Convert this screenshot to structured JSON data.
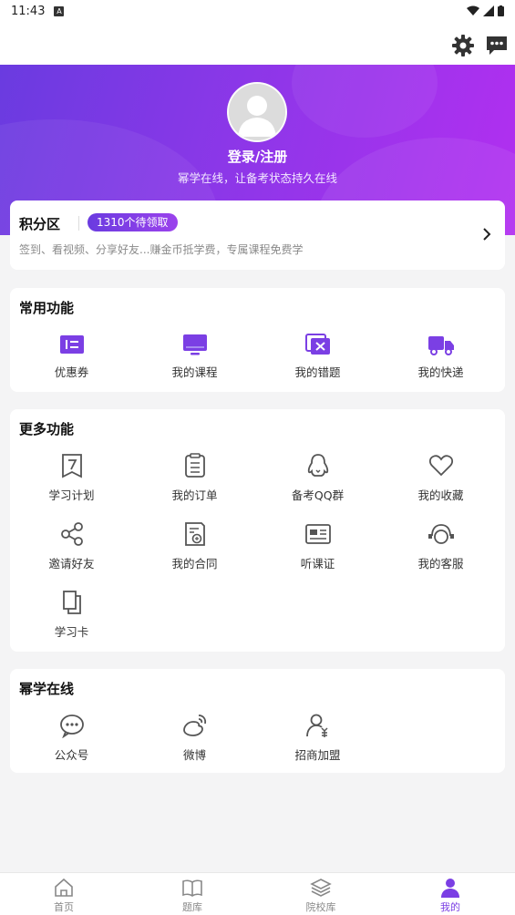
{
  "status_bar": {
    "time": "11:43",
    "notification_badge": "A"
  },
  "hero": {
    "login_label": "登录/注册",
    "slogan": "幂学在线，让备考状态持久在线",
    "gradient_start": "#6a3be0",
    "gradient_end": "#b22ff0"
  },
  "points": {
    "title": "积分区",
    "badge": "1310个待领取",
    "description": "签到、看视频、分享好友...赚金币抵学费，专属课程免费学"
  },
  "common_functions": {
    "title": "常用功能",
    "items": [
      {
        "label": "优惠券",
        "icon": "coupon-icon"
      },
      {
        "label": "我的课程",
        "icon": "monitor-icon"
      },
      {
        "label": "我的错题",
        "icon": "wrong-questions-icon"
      },
      {
        "label": "我的快递",
        "icon": "truck-icon"
      }
    ]
  },
  "more_functions": {
    "title": "更多功能",
    "items": [
      {
        "label": "学习计划",
        "icon": "study-plan-icon"
      },
      {
        "label": "我的订单",
        "icon": "clipboard-icon"
      },
      {
        "label": "备考QQ群",
        "icon": "qq-icon"
      },
      {
        "label": "我的收藏",
        "icon": "heart-icon"
      },
      {
        "label": "邀请好友",
        "icon": "share-icon"
      },
      {
        "label": "我的合同",
        "icon": "contract-icon"
      },
      {
        "label": "听课证",
        "icon": "id-card-icon"
      },
      {
        "label": "我的客服",
        "icon": "headset-icon"
      },
      {
        "label": "学习卡",
        "icon": "study-card-icon"
      }
    ]
  },
  "mixue_online": {
    "title": "幂学在线",
    "items": [
      {
        "label": "公众号",
        "icon": "wechat-icon"
      },
      {
        "label": "微博",
        "icon": "weibo-icon"
      },
      {
        "label": "招商加盟",
        "icon": "franchise-icon"
      }
    ]
  },
  "tabbar": {
    "tabs": [
      {
        "label": "首页",
        "icon": "home-icon"
      },
      {
        "label": "题库",
        "icon": "book-icon"
      },
      {
        "label": "院校库",
        "icon": "layers-icon"
      },
      {
        "label": "我的",
        "icon": "profile-icon"
      }
    ],
    "active_tab": "我的",
    "accent_color": "#7b3fe4"
  }
}
